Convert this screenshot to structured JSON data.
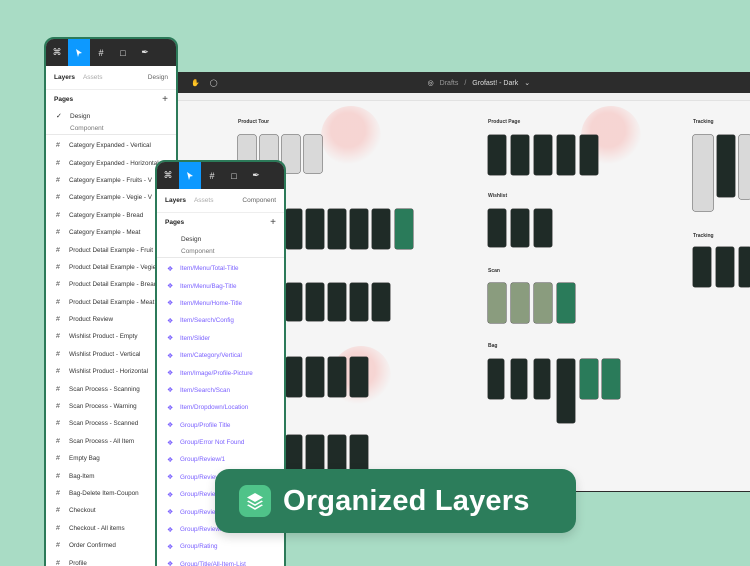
{
  "canvas": {
    "breadcrumb_drafts": "Drafts",
    "breadcrumb_sep": "/",
    "breadcrumb_file": "Grofast! - Dark",
    "frames": [
      {
        "label": "Product Tour"
      },
      {
        "label": "Product Page"
      },
      {
        "label": "Tracking"
      },
      {
        "label": "Wishlist"
      },
      {
        "label": "Scan"
      },
      {
        "label": "Bag"
      },
      {
        "label": "Tracking"
      }
    ]
  },
  "back_panel": {
    "tab_layers": "Layers",
    "tab_assets": "Assets",
    "tab_design": "Design",
    "pages_label": "Pages",
    "pages": [
      "Design",
      "Component"
    ],
    "layers": [
      "Category Expanded - Vertical",
      "Category Expanded - Horizontal",
      "Category Example - Fruits - V",
      "Category Example - Vegie - V",
      "Category Example - Bread",
      "Category Example - Meat",
      "Product Detail Example - Fruit",
      "Product Detail Example - Vegie",
      "Product Detail Example - Bread",
      "Product Detail Example - Meat",
      "Product Review",
      "Wishlist Product - Empty",
      "Wishlist Product - Vertical",
      "Wishlist Product - Horizontal",
      "Scan Process - Scanning",
      "Scan Process - Warning",
      "Scan Process - Scanned",
      "Scan Process - All Item",
      "Empty Bag",
      "Bag-Item",
      "Bag-Delete Item-Coupon",
      "Checkout",
      "Checkout - All items",
      "Order Confirmed",
      "Profile"
    ]
  },
  "front_panel": {
    "tab_layers": "Layers",
    "tab_assets": "Assets",
    "tab_component": "Component",
    "pages_label": "Pages",
    "pages": [
      "Design",
      "Component"
    ],
    "components": [
      "Item/Menu/Total-Title",
      "Item/Menu/Bag-Title",
      "Item/Menu/Home-Title",
      "Item/Search/Config",
      "Item/Slider",
      "Item/Category/Vertical",
      "Item/Image/Profile-Picture",
      "Item/Search/Scan",
      "Item/Dropdown/Location",
      "Group/Profile Title",
      "Group/Error Not Found",
      "Group/Review/1",
      "Group/Review/2",
      "Group/Review/3",
      "Group/Review/4",
      "Group/Review/5",
      "Group/Rating",
      "Group/Title/All-Item-List"
    ]
  },
  "badge": {
    "text": "Organized Layers",
    "accent": "#2c7d5b",
    "icon": "layers-icon"
  },
  "colors": {
    "background": "#a9dcc5",
    "selection": "#0d99ff",
    "component": "#7b61ff"
  }
}
